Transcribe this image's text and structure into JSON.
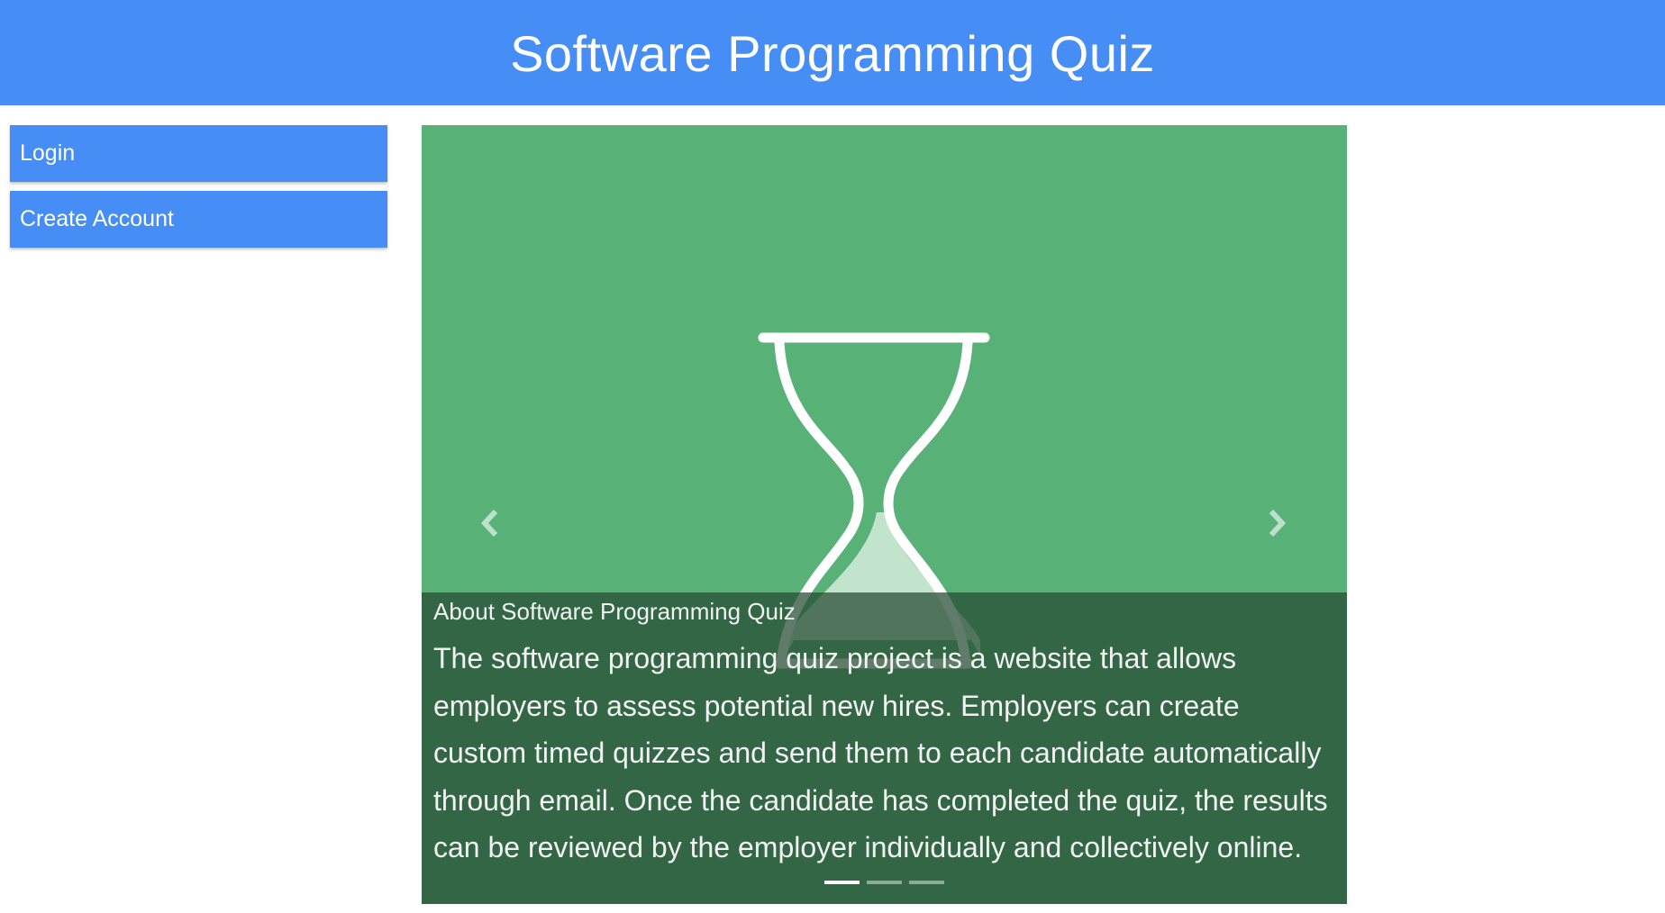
{
  "header": {
    "title": "Software Programming Quiz"
  },
  "sidebar": {
    "items": [
      {
        "label": "Login"
      },
      {
        "label": "Create Account"
      }
    ]
  },
  "carousel": {
    "slide_icon": "hourglass-icon",
    "caption_title": "About Software Programming Quiz",
    "caption_text": "The software programming quiz project is a website that allows employers to assess potential new hires. Employers can create custom timed quizzes and send them to each candidate automatically through email. Once the candidate has completed the quiz, the results can be reviewed by the employer individually and collectively online.",
    "prev_icon": "chevron-left-icon",
    "next_icon": "chevron-right-icon",
    "indicators": {
      "count": 3,
      "active_index": 0
    }
  },
  "colors": {
    "header_bg": "#468ef5",
    "button_bg": "#468ef5",
    "slide_bg": "#58b278",
    "caption_bg": "#244831"
  }
}
